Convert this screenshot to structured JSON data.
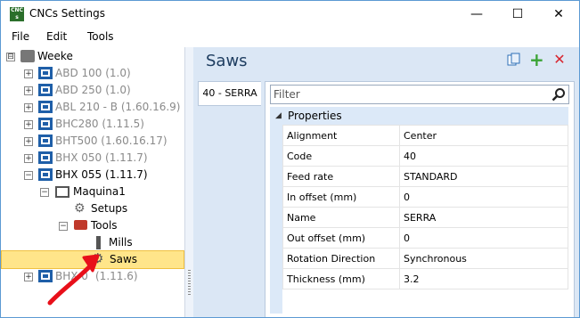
{
  "app": {
    "title": "CNCs Settings",
    "icon_text_top": "CNC",
    "icon_text_bottom": "s"
  },
  "window_controls": {
    "minimize": "—",
    "maximize": "☐",
    "close": "✕"
  },
  "menu": {
    "file": "File",
    "edit": "Edit",
    "tools": "Tools"
  },
  "tree": {
    "root": {
      "label": "Weeke",
      "expander": "⊟"
    },
    "machines": [
      {
        "label": "ABD 100 (1.0)",
        "expander": "+"
      },
      {
        "label": "ABD 250 (1.0)",
        "expander": "+"
      },
      {
        "label": "ABL 210 - B (1.60.16.9)",
        "expander": "+"
      },
      {
        "label": "BHC280 (1.11.5)",
        "expander": "+"
      },
      {
        "label": "BHT500 (1.60.16.17)",
        "expander": "+"
      },
      {
        "label": "BHX 050 (1.11.7)",
        "expander": "+"
      },
      {
        "label": "BHX 055 (1.11.7)",
        "expander": "−"
      }
    ],
    "maquina": {
      "label": "Maquina1",
      "expander": "−"
    },
    "setups": {
      "label": "Setups"
    },
    "tools": {
      "label": "Tools",
      "expander": "−"
    },
    "mills": {
      "label": "Mills"
    },
    "saws": {
      "label": "Saws"
    },
    "last": {
      "label": "BHX 0",
      "label_tail": "(1.11.6)",
      "expander": "+"
    }
  },
  "panel": {
    "title": "Saws",
    "icons": {
      "copy": "copy-icon",
      "add": "add-icon",
      "delete": "delete-icon"
    }
  },
  "tab": {
    "label": "40 - SERRA"
  },
  "filter": {
    "placeholder": "Filter"
  },
  "properties": {
    "header": "Properties",
    "rows": [
      {
        "key": "Alignment",
        "value": "Center"
      },
      {
        "key": "Code",
        "value": "40"
      },
      {
        "key": "Feed rate",
        "value": "STANDARD"
      },
      {
        "key": "In offset (mm)",
        "value": "0"
      },
      {
        "key": "Name",
        "value": "SERRA"
      },
      {
        "key": "Out offset (mm)",
        "value": "0"
      },
      {
        "key": "Rotation Direction",
        "value": "Synchronous"
      },
      {
        "key": "Thickness (mm)",
        "value": "3.2"
      }
    ]
  },
  "colors": {
    "accent": "#1e3d60",
    "selection": "#ffe58a",
    "panel_bg": "#dbe7f5",
    "annotation_arrow": "#e8101a"
  }
}
